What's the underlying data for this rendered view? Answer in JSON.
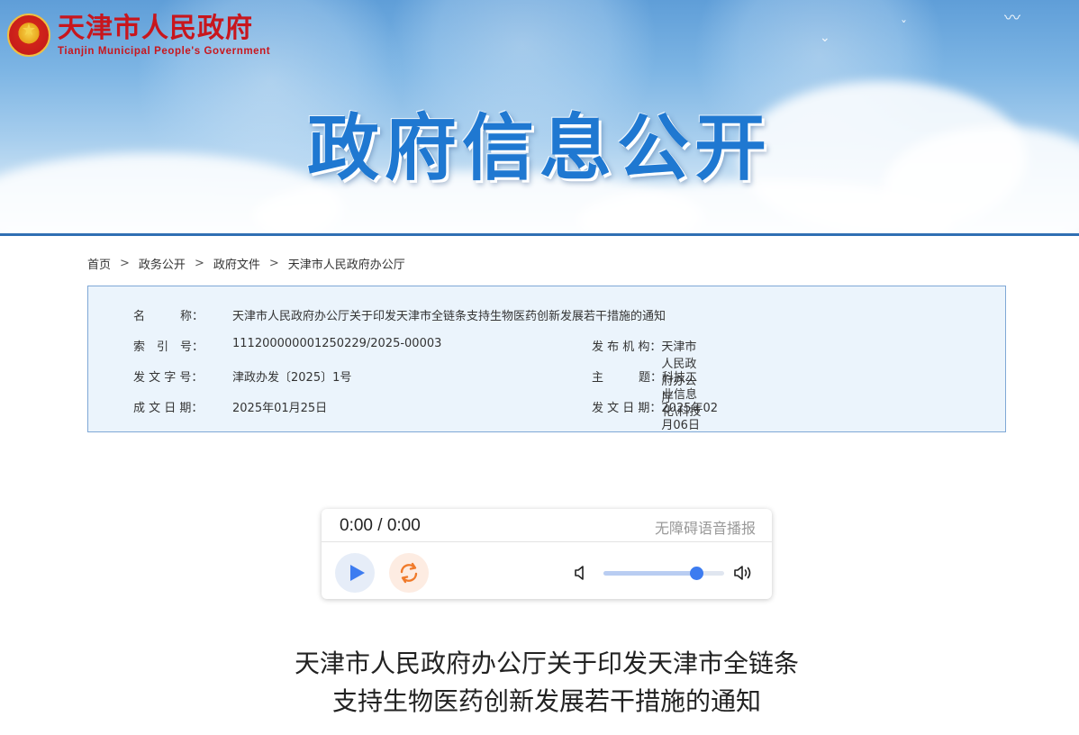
{
  "site": {
    "name_cn": "天津市人民政府",
    "name_en": "Tianjin Municipal People's Government"
  },
  "banner": {
    "title": "政府信息公开"
  },
  "breadcrumb": {
    "items": [
      "首页",
      "政务公开",
      "政府文件",
      "天津市人民政府办公厅"
    ],
    "separator": ">"
  },
  "info": {
    "name_label": "名　　　称：",
    "name_value": "天津市人民政府办公厅关于印发天津市全链条支持生物医药创新发展若干措施的通知",
    "index_label": "索　引　号：",
    "index_value": "111200000001250229/2025-00003",
    "issuer_label": "发 布 机 构：",
    "issuer_value": "天津市人民政府办公厅",
    "docno_label": "发 文 字 号：",
    "docno_value": "津政办发〔2025〕1号",
    "subject_label": "主　　　题：",
    "subject_value": "科技工业信息化\\科技",
    "created_label": "成 文 日 期：",
    "created_value": "2025年01月25日",
    "published_label": "发 文 日 期：",
    "published_value": "2025年02月06日"
  },
  "player": {
    "time": "0:00 / 0:00",
    "label": "无障碍语音播报",
    "volume": 0.77,
    "icons": {
      "play": "play-icon",
      "loop": "loop-icon",
      "volume_low": "volume-low-icon",
      "volume_high": "volume-high-icon"
    }
  },
  "article": {
    "title_line1": "天津市人民政府办公厅关于印发天津市全链条",
    "title_line2": "支持生物医药创新发展若干措施的通知"
  },
  "colors": {
    "brand_red": "#c8161d",
    "banner_title_blue": "#1f78d1",
    "accent_blue": "#3d7cf0",
    "loop_orange": "#f07a2a"
  }
}
